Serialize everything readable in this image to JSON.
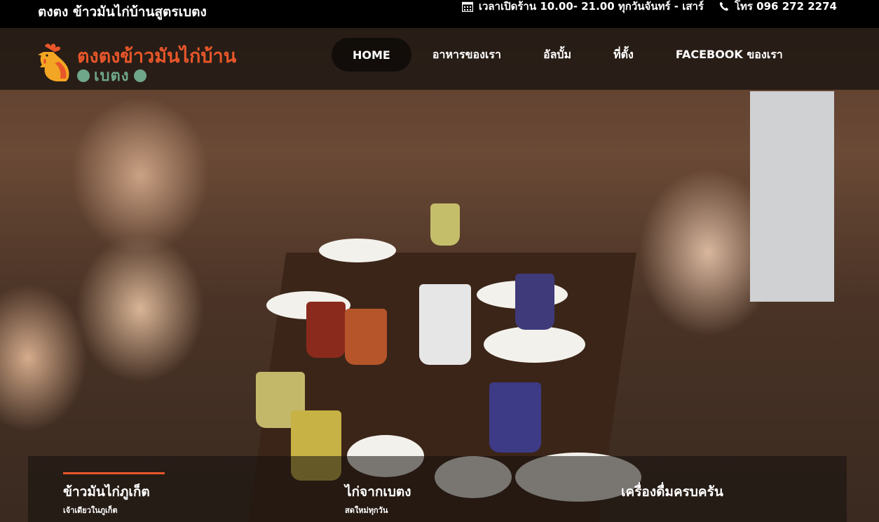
{
  "topbar": {
    "brand_title": "ตงตง ข้าวมันไก่บ้านสูตรเบตง",
    "hours_icon": "calendar-icon",
    "hours": "เวลาเปิดร้าน 10.00- 21.00 ทุกวันจันทร์ - เสาร์",
    "phone_icon": "phone-icon",
    "phone": "โทร 096 272 2274"
  },
  "logo": {
    "line1": "ตงตงข้าวมันไก่บ้าน",
    "line2": "เบตง",
    "icon": "rooster-icon",
    "colors": {
      "primary": "#e8562a",
      "secondary": "#6fa78a"
    }
  },
  "nav": {
    "items": [
      {
        "label": "HOME",
        "active": true
      },
      {
        "label": "อาหารของเรา",
        "active": false
      },
      {
        "label": "อัลบั้ม",
        "active": false
      },
      {
        "label": "ที่ตั้ง",
        "active": false
      },
      {
        "label": "FACEBOOK ของเรา",
        "active": false
      }
    ]
  },
  "features": [
    {
      "title": "ข้าวมันไก่ภูเก็ต",
      "subtitle": "เจ้าเดียวในภูเก็ต",
      "accent": true
    },
    {
      "title": "ไก่จากเบตง",
      "subtitle": "สดใหม่ทุกวัน",
      "accent": false
    },
    {
      "title": "เครื่องดื่มครบครัน",
      "subtitle": "",
      "accent": false
    }
  ],
  "colors": {
    "accent": "#e8562a",
    "topbar_bg": "#000000"
  }
}
